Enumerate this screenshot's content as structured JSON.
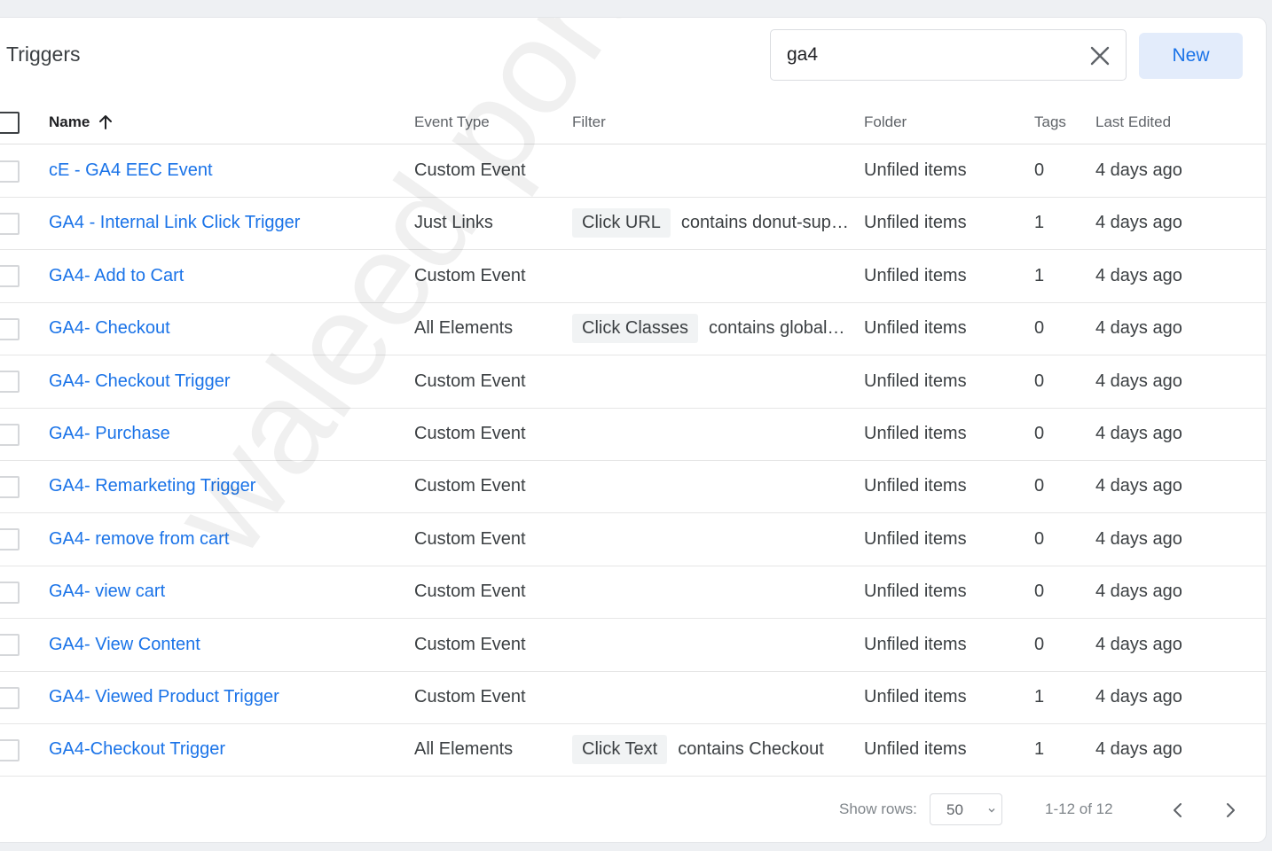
{
  "header": {
    "title": "Triggers",
    "search_value": "ga4",
    "new_label": "New"
  },
  "columns": {
    "name": "Name",
    "event_type": "Event Type",
    "filter": "Filter",
    "folder": "Folder",
    "tags": "Tags",
    "last_edited": "Last Edited"
  },
  "rows": [
    {
      "name": "cE - GA4 EEC Event",
      "event_type": "Custom Event",
      "filter_chip": "",
      "filter_value": "",
      "folder": "Unfiled items",
      "tags": "0",
      "last_edited": "4 days ago"
    },
    {
      "name": "GA4 - Internal Link Click Trigger",
      "event_type": "Just Links",
      "filter_chip": "Click URL",
      "filter_value": "contains donut-sup…",
      "folder": "Unfiled items",
      "tags": "1",
      "last_edited": "4 days ago"
    },
    {
      "name": "GA4- Add to Cart",
      "event_type": "Custom Event",
      "filter_chip": "",
      "filter_value": "",
      "folder": "Unfiled items",
      "tags": "1",
      "last_edited": "4 days ago"
    },
    {
      "name": "GA4- Checkout",
      "event_type": "All Elements",
      "filter_chip": "Click Classes",
      "filter_value": "contains global…",
      "folder": "Unfiled items",
      "tags": "0",
      "last_edited": "4 days ago"
    },
    {
      "name": "GA4- Checkout Trigger",
      "event_type": "Custom Event",
      "filter_chip": "",
      "filter_value": "",
      "folder": "Unfiled items",
      "tags": "0",
      "last_edited": "4 days ago"
    },
    {
      "name": "GA4- Purchase",
      "event_type": "Custom Event",
      "filter_chip": "",
      "filter_value": "",
      "folder": "Unfiled items",
      "tags": "0",
      "last_edited": "4 days ago"
    },
    {
      "name": "GA4- Remarketing Trigger",
      "event_type": "Custom Event",
      "filter_chip": "",
      "filter_value": "",
      "folder": "Unfiled items",
      "tags": "0",
      "last_edited": "4 days ago"
    },
    {
      "name": "GA4- remove from cart",
      "event_type": "Custom Event",
      "filter_chip": "",
      "filter_value": "",
      "folder": "Unfiled items",
      "tags": "0",
      "last_edited": "4 days ago"
    },
    {
      "name": "GA4- view cart",
      "event_type": "Custom Event",
      "filter_chip": "",
      "filter_value": "",
      "folder": "Unfiled items",
      "tags": "0",
      "last_edited": "4 days ago"
    },
    {
      "name": "GA4- View Content",
      "event_type": "Custom Event",
      "filter_chip": "",
      "filter_value": "",
      "folder": "Unfiled items",
      "tags": "0",
      "last_edited": "4 days ago"
    },
    {
      "name": "GA4- Viewed Product Trigger",
      "event_type": "Custom Event",
      "filter_chip": "",
      "filter_value": "",
      "folder": "Unfiled items",
      "tags": "1",
      "last_edited": "4 days ago"
    },
    {
      "name": "GA4-Checkout Trigger",
      "event_type": "All Elements",
      "filter_chip": "Click Text",
      "filter_value": "contains Checkout",
      "folder": "Unfiled items",
      "tags": "1",
      "last_edited": "4 days ago"
    }
  ],
  "footer": {
    "show_rows_label": "Show rows:",
    "rows_per_page": "50",
    "range": "1-12 of 12"
  },
  "watermark": "waleed portfolio",
  "colors": {
    "link": "#1a73e8",
    "new_button_bg": "#e3ecfb",
    "page_bg": "#eef0f3"
  },
  "icons": {
    "clear": "close-icon",
    "sort": "arrow-up-icon",
    "select": "chevron-down-icon",
    "prev": "chevron-left-icon",
    "next": "chevron-right-icon"
  }
}
